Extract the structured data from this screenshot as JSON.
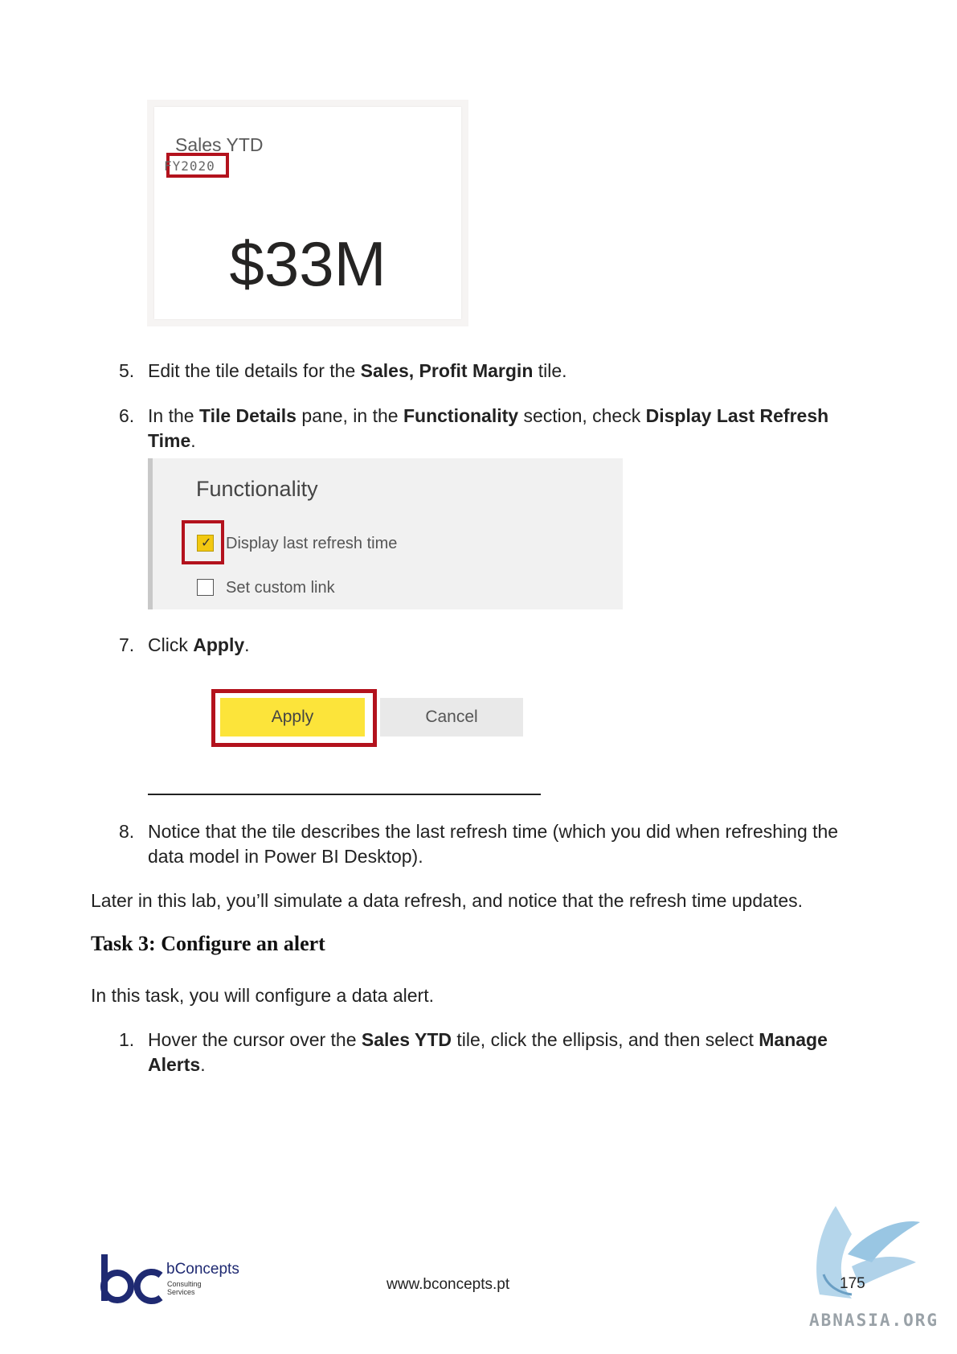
{
  "tile": {
    "title": "Sales YTD",
    "subtitle": "FY2020",
    "value": "$33M"
  },
  "steps": {
    "s5": {
      "num": "5.",
      "pre": "Edit the tile details for the ",
      "bold1": "Sales, Profit Margin",
      "post": " tile."
    },
    "s6": {
      "num": "6.",
      "pre": "In the ",
      "bold1": "Tile Details",
      "mid1": " pane, in the ",
      "bold2": "Functionality",
      "mid2": " section, check ",
      "bold3": "Display Last Refresh Time",
      "post": "."
    },
    "s7": {
      "num": "7.",
      "pre": "Click ",
      "bold1": "Apply",
      "post": "."
    },
    "s8": {
      "num": "8.",
      "text": "Notice that the tile describes the last refresh time (which you did when refreshing the data model in Power BI Desktop)."
    },
    "t1": {
      "num": "1.",
      "pre": "Hover the cursor over the ",
      "bold1": "Sales YTD",
      "mid1": " tile, click the ellipsis, and then select ",
      "bold2": "Manage Alerts",
      "post": "."
    }
  },
  "functionality": {
    "title": "Functionality",
    "option1": "Display last refresh time",
    "option1_checked": true,
    "option2": "Set custom link",
    "option2_checked": false
  },
  "buttons": {
    "apply": "Apply",
    "cancel": "Cancel"
  },
  "paragraphs": {
    "later": "Later in this lab, you’ll simulate a data refresh, and notice that the refresh time updates.",
    "task_intro": "In this task, you will configure a data alert."
  },
  "task_heading": "Task 3: Configure an alert",
  "footer": {
    "logo_name": "bConcepts",
    "logo_tagline_1": "Consulting",
    "logo_tagline_2": "Services",
    "url": "www.bconcepts.pt",
    "page_number": "175",
    "watermark": "ABNASIA.ORG"
  },
  "colors": {
    "highlight_red": "#b3121d",
    "powerbi_yellow": "#f2c811",
    "apply_yellow": "#fce43a",
    "brand_navy": "#1f2a72"
  }
}
